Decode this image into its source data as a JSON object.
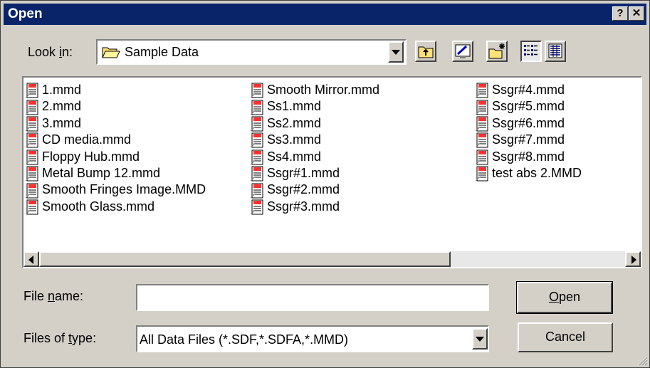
{
  "window": {
    "title": "Open"
  },
  "titlebar": {
    "help_label": "?",
    "close_label": "✕"
  },
  "lookin": {
    "label_pre": "Look ",
    "label_u": "i",
    "label_post": "n:",
    "value": "Sample Data"
  },
  "toolbar": {
    "icons": [
      "up-one-level-icon",
      "desktop-icon",
      "new-folder-icon",
      "list-view-icon",
      "details-view-icon"
    ]
  },
  "files": {
    "col1": [
      "1.mmd",
      "2.mmd",
      "3.mmd",
      "CD media.mmd",
      "Floppy Hub.mmd",
      "Metal Bump 12.mmd",
      "Smooth Fringes Image.MMD",
      "Smooth Glass.mmd"
    ],
    "col2": [
      "Smooth Mirror.mmd",
      "Ss1.mmd",
      "Ss2.mmd",
      "Ss3.mmd",
      "Ss4.mmd",
      "Ssgr#1.mmd",
      "Ssgr#2.mmd",
      "Ssgr#3.mmd"
    ],
    "col3": [
      "Ssgr#4.mmd",
      "Ssgr#5.mmd",
      "Ssgr#6.mmd",
      "Ssgr#7.mmd",
      "Ssgr#8.mmd",
      "test abs 2.MMD"
    ]
  },
  "filename": {
    "label_pre": "File ",
    "label_u": "n",
    "label_post": "ame:",
    "value": ""
  },
  "filetype": {
    "label_pre": "Files of ",
    "label_u": "t",
    "label_post": "ype:",
    "value": "All Data Files (*.SDF,*.SDFA,*.MMD)"
  },
  "buttons": {
    "open_u": "O",
    "open_rest": "pen",
    "cancel": "Cancel"
  },
  "colors": {
    "titlebar": "#0a246a",
    "face": "#d4d0c8"
  }
}
